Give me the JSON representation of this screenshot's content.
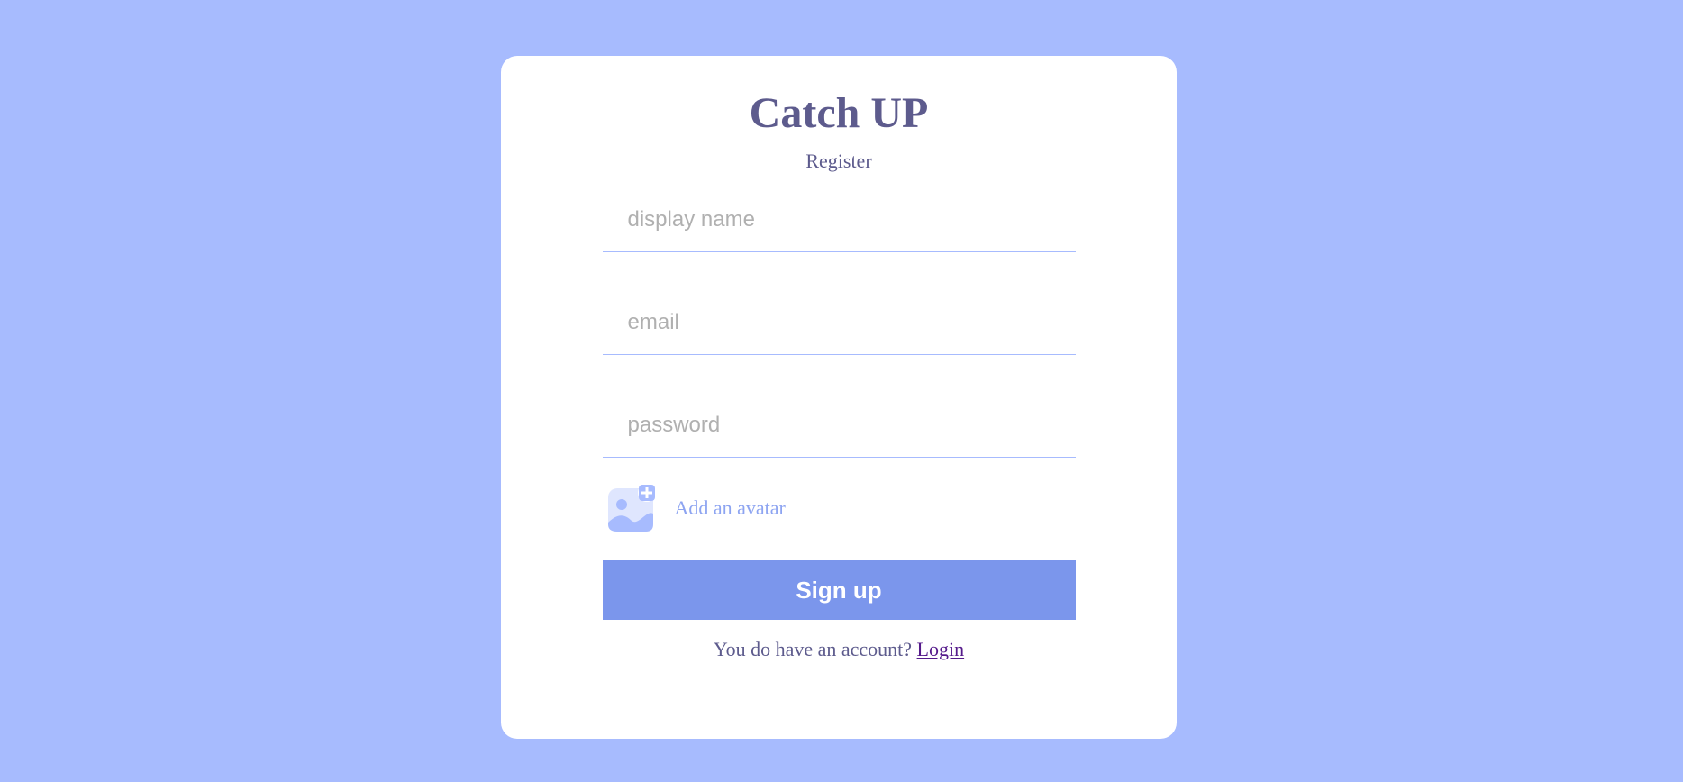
{
  "app": {
    "logo": "Catch UP",
    "subtitle": "Register"
  },
  "form": {
    "display_name": {
      "placeholder": "display name",
      "value": ""
    },
    "email": {
      "placeholder": "email",
      "value": ""
    },
    "password": {
      "placeholder": "password",
      "value": ""
    },
    "avatar": {
      "label": "Add an avatar",
      "icon": "add-image-icon"
    },
    "submit_label": "Sign up"
  },
  "footer": {
    "prompt": "You do have an account?",
    "link_label": "Login"
  },
  "colors": {
    "background": "#a7bbfe",
    "card": "#ffffff",
    "primary_text": "#5d5b8d",
    "button": "#7b96ec",
    "accent_link": "#8da4f1",
    "visited_link": "#551a8b"
  }
}
